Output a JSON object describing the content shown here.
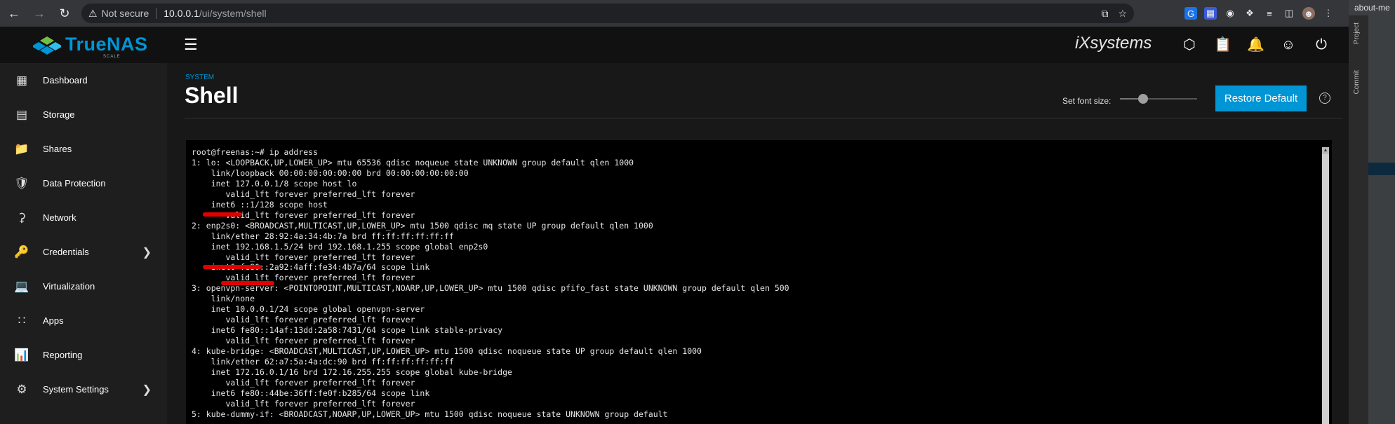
{
  "browser": {
    "not_secure": "Not secure",
    "url_host": "10.0.0.1",
    "url_path": "/ui/system/shell"
  },
  "header": {
    "brand": "TrueNAS",
    "brand_sub": "SCALE",
    "vendor": "iXsystems"
  },
  "sidebar": {
    "items": [
      {
        "label": "Dashboard",
        "icon": "dashboard-icon"
      },
      {
        "label": "Storage",
        "icon": "storage-icon"
      },
      {
        "label": "Shares",
        "icon": "shares-folder-icon"
      },
      {
        "label": "Data Protection",
        "icon": "shield-icon"
      },
      {
        "label": "Network",
        "icon": "network-icon"
      },
      {
        "label": "Credentials",
        "icon": "key-icon",
        "has_children": true
      },
      {
        "label": "Virtualization",
        "icon": "laptop-icon"
      },
      {
        "label": "Apps",
        "icon": "apps-grid-icon"
      },
      {
        "label": "Reporting",
        "icon": "chart-icon"
      },
      {
        "label": "System Settings",
        "icon": "gear-icon",
        "has_children": true
      }
    ]
  },
  "main": {
    "section": "System",
    "title": "Shell",
    "font_size_label": "Set font size:",
    "font_size_fraction": 0.3,
    "restore_button": "Restore Default",
    "accent": "#0095d5"
  },
  "terminal": {
    "lines": [
      "root@freenas:~# ip address",
      "1: lo: <LOOPBACK,UP,LOWER_UP> mtu 65536 qdisc noqueue state UNKNOWN group default qlen 1000",
      "    link/loopback 00:00:00:00:00:00 brd 00:00:00:00:00:00",
      "    inet 127.0.0.1/8 scope host lo",
      "       valid_lft forever preferred_lft forever",
      "    inet6 ::1/128 scope host",
      "       valid_lft forever preferred_lft forever",
      "2: enp2s0: <BROADCAST,MULTICAST,UP,LOWER_UP> mtu 1500 qdisc mq state UP group default qlen 1000",
      "    link/ether 28:92:4a:34:4b:7a brd ff:ff:ff:ff:ff:ff",
      "    inet 192.168.1.5/24 brd 192.168.1.255 scope global enp2s0",
      "       valid_lft forever preferred_lft forever",
      "    inet6 fe80::2a92:4aff:fe34:4b7a/64 scope link",
      "       valid_lft forever preferred_lft forever",
      "3: openvpn-server: <POINTOPOINT,MULTICAST,NOARP,UP,LOWER_UP> mtu 1500 qdisc pfifo_fast state UNKNOWN group default qlen 500",
      "    link/none",
      "    inet 10.0.0.1/24 scope global openvpn-server",
      "       valid_lft forever preferred_lft forever",
      "    inet6 fe80::14af:13dd:2a58:7431/64 scope link stable-privacy",
      "       valid_lft forever preferred_lft forever",
      "4: kube-bridge: <BROADCAST,MULTICAST,UP,LOWER_UP> mtu 1500 qdisc noqueue state UP group default qlen 1000",
      "    link/ether 62:a7:5a:4a:dc:90 brd ff:ff:ff:ff:ff:ff",
      "    inet 172.16.0.1/16 brd 172.16.255.255 scope global kube-bridge",
      "       valid_lft forever preferred_lft forever",
      "    inet6 fe80::44be:36ff:fe0f:b285/64 scope link",
      "       valid_lft forever preferred_lft forever",
      "5: kube-dummy-if: <BROADCAST,NOARP,UP,LOWER_UP> mtu 1500 qdisc noqueue state UNKNOWN group default"
    ]
  },
  "ide": {
    "title": "about-me",
    "tab_project": "Project",
    "tab_commit": "Commit"
  }
}
